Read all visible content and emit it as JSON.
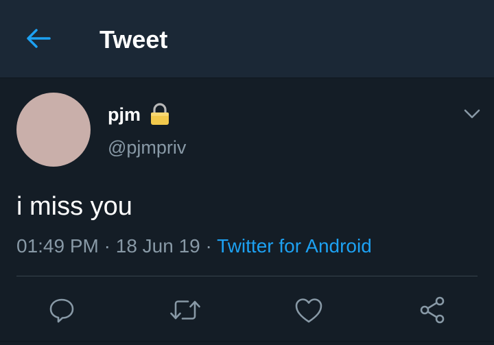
{
  "header": {
    "back_icon": "arrow-left-icon",
    "title": "Tweet",
    "accent_color": "#1da1f2"
  },
  "tweet": {
    "avatar_color": "#c9afaa",
    "display_name": "pjm",
    "lock_icon": "lock-icon",
    "handle": "@pjmpriv",
    "menu_icon": "chevron-down-icon",
    "text": "i miss you",
    "time": "01:49 PM",
    "separator": " · ",
    "date": "18 Jun 19",
    "source": "Twitter for Android"
  },
  "actions": [
    {
      "icon": "reply-icon"
    },
    {
      "icon": "retweet-icon"
    },
    {
      "icon": "like-icon"
    },
    {
      "icon": "share-icon"
    }
  ],
  "colors": {
    "background": "#141d26",
    "header_background": "#1b2836",
    "secondary_text": "#8899a6",
    "link": "#1da1f2",
    "divider": "#38444d"
  }
}
